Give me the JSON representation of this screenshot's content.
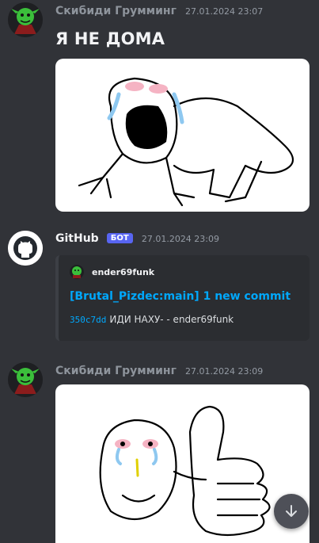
{
  "messages": [
    {
      "author": "Скибиди Грумминг",
      "timestamp": "27.01.2024 23:07",
      "text": "Я НЕ ДОМА",
      "avatar_icon": "green-goblin-avatar",
      "image": "crying-cartoon-creature-drawing"
    },
    {
      "author": "GitHub",
      "badge": "БОТ",
      "timestamp": "27.01.2024 23:09",
      "avatar_icon": "github-icon",
      "embed": {
        "author": "ender69funk",
        "title": "[Brutal_Pizdec:main] 1 new commit",
        "commit_hash": "350c7dd",
        "commit_message": "ИДИ НАХУ- - ender69funk"
      }
    },
    {
      "author": "Скибиди Грумминг",
      "timestamp": "27.01.2024 23:09",
      "avatar_icon": "green-goblin-avatar",
      "image": "crying-thumbs-up-drawing"
    }
  ],
  "scroll_button_icon": "arrow-down-icon",
  "colors": {
    "background": "#313338",
    "embed_background": "#2b2d31",
    "link": "#00a8fc",
    "bot_badge": "#5865f2"
  }
}
